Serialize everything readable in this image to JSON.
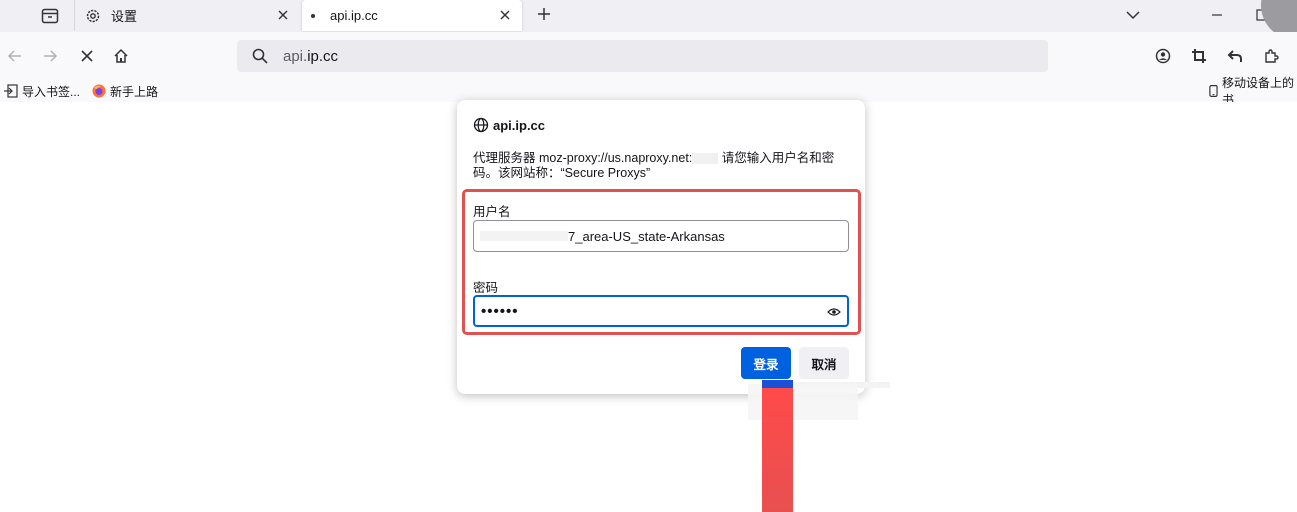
{
  "tabs": [
    {
      "label": "设置",
      "icon": "gear-icon"
    },
    {
      "label": "api.ip.cc",
      "icon": "loading-dot-icon"
    }
  ],
  "url": {
    "host_prefix": "api.",
    "host_main": "ip.cc"
  },
  "bookmarks": {
    "import_label": "导入书签...",
    "getting_started_label": "新手上路",
    "mobile_label": "移动设备上的书"
  },
  "dialog": {
    "host": "api.ip.cc",
    "message_part1": "代理服务器 moz-proxy://us.naproxy.net:",
    "message_part2": " 请您输入用户名和密码。该网站称：“Secure Proxys”",
    "username_label": "用户名",
    "username_value_suffix": "7_area-US_state-Arkansas",
    "password_label": "密码",
    "password_value": "••••••",
    "login_button": "登录",
    "cancel_button": "取消"
  },
  "colors": {
    "primary": "#0061e0",
    "highlight_border": "#e05252",
    "arrow": "#ff4a4a"
  }
}
